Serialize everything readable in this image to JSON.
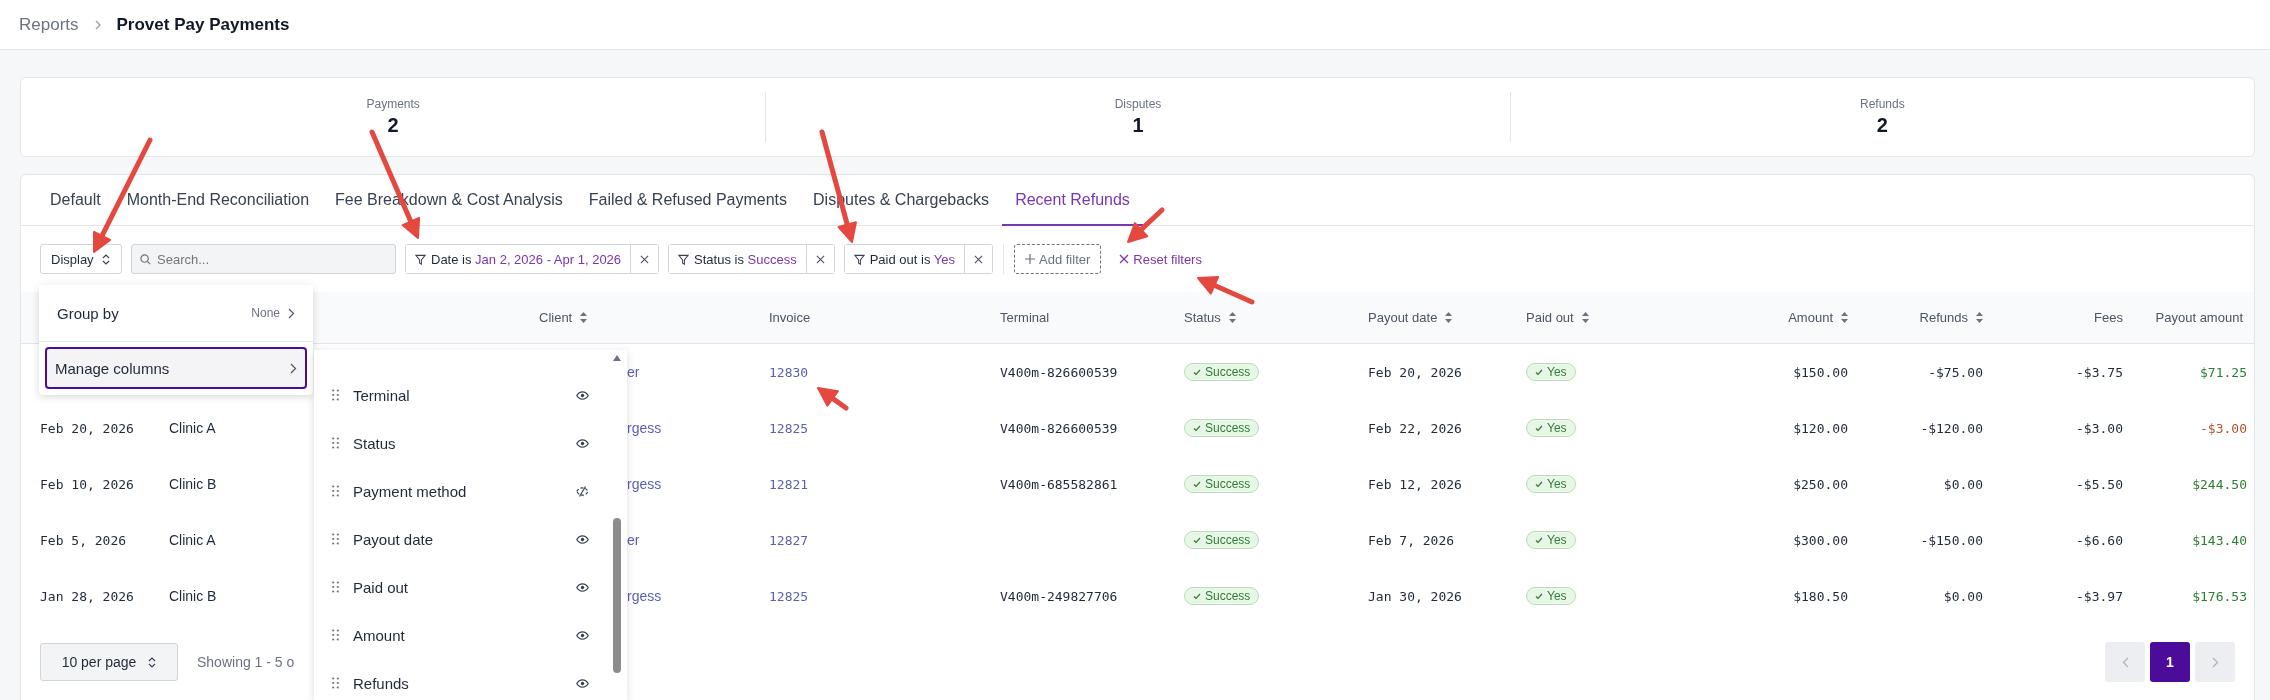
{
  "breadcrumb": {
    "parent": "Reports",
    "current": "Provet Pay Payments"
  },
  "summary": [
    {
      "label": "Payments",
      "value": "2"
    },
    {
      "label": "Disputes",
      "value": "1"
    },
    {
      "label": "Refunds",
      "value": "2"
    }
  ],
  "tabs": [
    {
      "label": "Default",
      "selected": false
    },
    {
      "label": "Month-End Reconciliation",
      "selected": false
    },
    {
      "label": "Fee Breakdown & Cost Analysis",
      "selected": false
    },
    {
      "label": "Failed & Refused Payments",
      "selected": false
    },
    {
      "label": "Disputes & Chargebacks",
      "selected": false
    },
    {
      "label": "Recent Refunds",
      "selected": true
    }
  ],
  "toolbar": {
    "display": "Display",
    "search_placeholder": "Search...",
    "filters": [
      {
        "field": "Date is",
        "value": "Jan 2, 2026 - Apr 1, 2026"
      },
      {
        "field": "Status is",
        "value": "Success"
      },
      {
        "field": "Paid out is",
        "value": "Yes"
      }
    ],
    "add_filter": "Add filter",
    "reset": "Reset filters"
  },
  "display_menu": {
    "items": [
      {
        "label": "Group by",
        "value": "None",
        "selected": false
      },
      {
        "label": "Manage columns",
        "selected": true
      }
    ]
  },
  "columns_menu": {
    "items": [
      {
        "label": "Terminal",
        "visible": true
      },
      {
        "label": "Status",
        "visible": true
      },
      {
        "label": "Payment method",
        "visible": false
      },
      {
        "label": "Payout date",
        "visible": true
      },
      {
        "label": "Paid out",
        "visible": true
      },
      {
        "label": "Amount",
        "visible": true
      },
      {
        "label": "Refunds",
        "visible": true
      }
    ]
  },
  "table": {
    "columns": [
      {
        "label": "Client",
        "sortable": true
      },
      {
        "label": "Invoice",
        "sortable": false
      },
      {
        "label": "Terminal",
        "sortable": false
      },
      {
        "label": "Status",
        "sortable": true
      },
      {
        "label": "Payout date",
        "sortable": true
      },
      {
        "label": "Paid out",
        "sortable": true
      },
      {
        "label": "Amount",
        "sortable": true
      },
      {
        "label": "Refunds",
        "sortable": true
      },
      {
        "label": "Fees",
        "sortable": false
      },
      {
        "label": "Payout amount",
        "sortable": false
      }
    ],
    "rows": [
      {
        "client": "er",
        "invoice": "12830",
        "terminal": "V400m-826600539",
        "status": "Success",
        "payout_date": "Feb 20, 2026",
        "paid_out": "Yes",
        "amount": "$150.00",
        "refunds": "-$75.00",
        "fees": "-$3.75",
        "payout_amount": "$71.25",
        "negative": false
      },
      {
        "date": "Feb 20, 2026",
        "clinic": "Clinic A",
        "client": "rgess",
        "invoice": "12825",
        "terminal": "V400m-826600539",
        "status": "Success",
        "payout_date": "Feb 22, 2026",
        "paid_out": "Yes",
        "amount": "$120.00",
        "refunds": "-$120.00",
        "fees": "-$3.00",
        "payout_amount": "-$3.00",
        "negative": true
      },
      {
        "date": "Feb 10, 2026",
        "clinic": "Clinic B",
        "client": "rgess",
        "invoice": "12821",
        "terminal": "V400m-685582861",
        "status": "Success",
        "payout_date": "Feb 12, 2026",
        "paid_out": "Yes",
        "amount": "$250.00",
        "refunds": "$0.00",
        "fees": "-$5.50",
        "payout_amount": "$244.50",
        "negative": false
      },
      {
        "date": "Feb 5, 2026",
        "clinic": "Clinic A",
        "client": "er",
        "invoice": "12827",
        "status": "Success",
        "payout_date": "Feb 7, 2026",
        "paid_out": "Yes",
        "amount": "$300.00",
        "refunds": "-$150.00",
        "fees": "-$6.60",
        "payout_amount": "$143.40",
        "negative": false
      },
      {
        "date": "Jan 28, 2026",
        "clinic": "Clinic B",
        "client": "rgess",
        "invoice": "12825",
        "terminal": "V400m-249827706",
        "status": "Success",
        "payout_date": "Jan 30, 2026",
        "paid_out": "Yes",
        "amount": "$180.50",
        "refunds": "$0.00",
        "fees": "-$3.97",
        "payout_amount": "$176.53",
        "negative": false
      }
    ]
  },
  "footer": {
    "per_page": "10 per page",
    "showing": "Showing 1 - 5 o",
    "prev_disabled": true,
    "next_disabled": true,
    "pages": [
      {
        "label": "1",
        "selected": true
      }
    ]
  }
}
